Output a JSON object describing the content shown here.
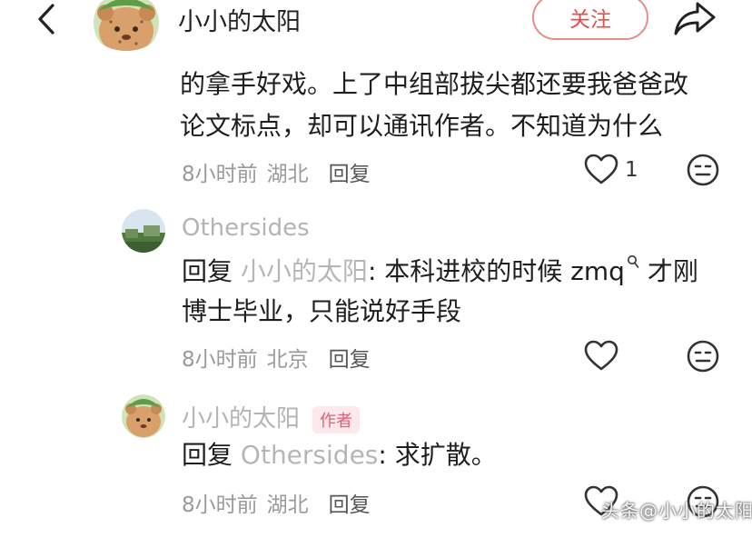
{
  "header": {
    "title": "小小的太阳",
    "follow_label": "关注"
  },
  "comment": {
    "lines": [
      "的拿手好戏。上了中组部拔尖都还要我爸爸改",
      "论文标点，却可以通讯作者。不知道为什么"
    ],
    "time": "8小时前",
    "location": "湖北",
    "reply_label": "回复",
    "likes": "1"
  },
  "replies": [
    {
      "author": "Othersides",
      "reply_prefix": "回复",
      "mention": "小小的太阳",
      "colon": ":",
      "text_line1": "本科进校的时候 zmq",
      "text_line1_after": " 才刚",
      "text_line2": "博士毕业，只能说好手段",
      "time": "8小时前",
      "location": "北京",
      "reply_label": "回复"
    },
    {
      "author": "小小的太阳",
      "badge": "作者",
      "reply_prefix": "回复",
      "mention": "Othersides",
      "colon": ":",
      "text": "求扩散。",
      "time": "8小时前",
      "location": "湖北",
      "reply_label": "回复"
    }
  ],
  "icons": {
    "back": "chevron-left-icon",
    "share": "share-arrow-icon",
    "like": "heart-outline-icon",
    "dislike": "neutral-face-icon",
    "search": "search-icon"
  },
  "colors": {
    "accent": "#e0504a",
    "muted": "#9a9a9a",
    "badge_bg": "#fde8ec",
    "badge_text": "#e0607a"
  },
  "watermark": "头条@小小的太阳"
}
